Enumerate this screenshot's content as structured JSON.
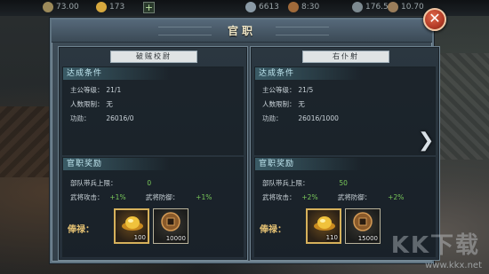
{
  "topbar": {
    "food": "73.00",
    "gold": "173",
    "troops": "6613",
    "time": "8:30",
    "value1": "176.5",
    "value2": "10.70"
  },
  "dialog": {
    "title": "官职",
    "close_glyph": "✕",
    "next_glyph": "❯"
  },
  "ranks": [
    {
      "name": "破贼校尉",
      "conditions_title": "达成条件",
      "conditions": [
        {
          "label": "主公等级：",
          "value": "21/1"
        },
        {
          "label": "人数限制：",
          "value": "无"
        },
        {
          "label": "功勋：",
          "value": "26016/0"
        }
      ],
      "rewards_title": "官职奖励",
      "troop_cap_label": "部队带兵上限：",
      "troop_cap_value": "0",
      "attack_label": "武将攻击：",
      "attack_value": "+1%",
      "defense_label": "武将防御：",
      "defense_value": "+1%",
      "salary_label": "俸禄：",
      "items": [
        {
          "icon": "gold-ingot-icon",
          "qty": "100"
        },
        {
          "icon": "copper-coin-icon",
          "qty": "10000"
        }
      ]
    },
    {
      "name": "右仆射",
      "conditions_title": "达成条件",
      "conditions": [
        {
          "label": "主公等级：",
          "value": "21/5"
        },
        {
          "label": "人数限制：",
          "value": "无"
        },
        {
          "label": "功勋：",
          "value": "26016/1000"
        }
      ],
      "rewards_title": "官职奖励",
      "troop_cap_label": "部队带兵上限：",
      "troop_cap_value": "50",
      "attack_label": "武将攻击：",
      "attack_value": "+2%",
      "defense_label": "武将防御：",
      "defense_value": "+2%",
      "salary_label": "俸禄：",
      "items": [
        {
          "icon": "gold-ingot-icon",
          "qty": "110"
        },
        {
          "icon": "copper-coin-icon",
          "qty": "15000"
        }
      ]
    }
  ],
  "watermark": {
    "logo": "KK下载",
    "url": "www.kkx.net"
  },
  "colors": {
    "accent_green": "#79c85a",
    "title_gold": "#f1e8c9",
    "close_red": "#b43b26"
  }
}
